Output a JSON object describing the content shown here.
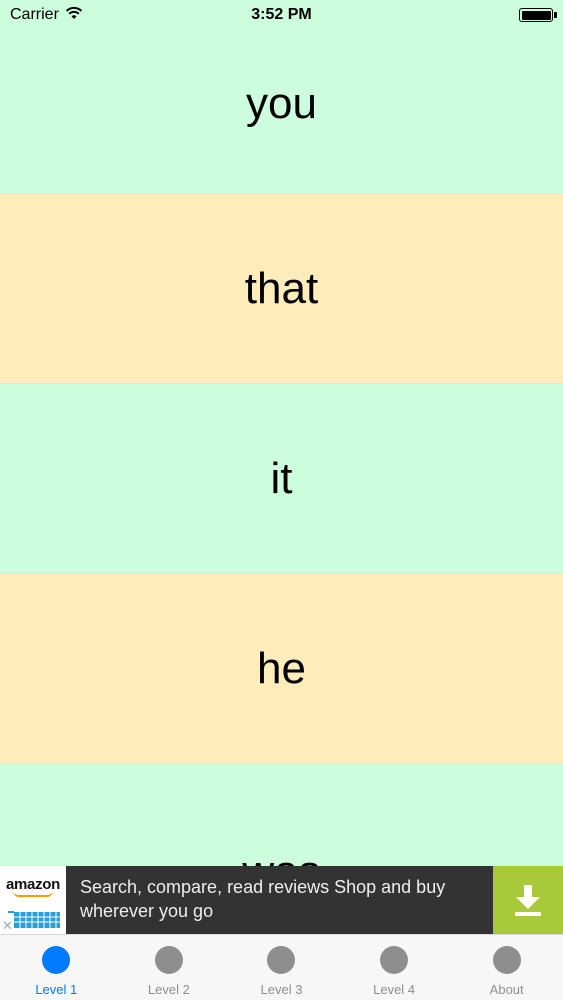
{
  "status_bar": {
    "carrier": "Carrier",
    "time": "3:52 PM"
  },
  "words": [
    {
      "text": "you",
      "color": "#ccfddd"
    },
    {
      "text": "that",
      "color": "#ffecbb"
    },
    {
      "text": "it",
      "color": "#ccfddd"
    },
    {
      "text": "he",
      "color": "#ffecbb"
    },
    {
      "text": "was",
      "color": "#ccfddd"
    }
  ],
  "ad": {
    "brand": "amazon",
    "text": "Search, compare, read reviews Shop and buy wherever you go",
    "close_symbol": "✕",
    "accent_color": "#a8c93a"
  },
  "tabs": [
    {
      "label": "Level 1",
      "active": true
    },
    {
      "label": "Level 2",
      "active": false
    },
    {
      "label": "Level 3",
      "active": false
    },
    {
      "label": "Level 4",
      "active": false
    },
    {
      "label": "About",
      "active": false
    }
  ],
  "colors": {
    "active_tab": "#007aff",
    "inactive_tab": "#8e8e8e"
  }
}
